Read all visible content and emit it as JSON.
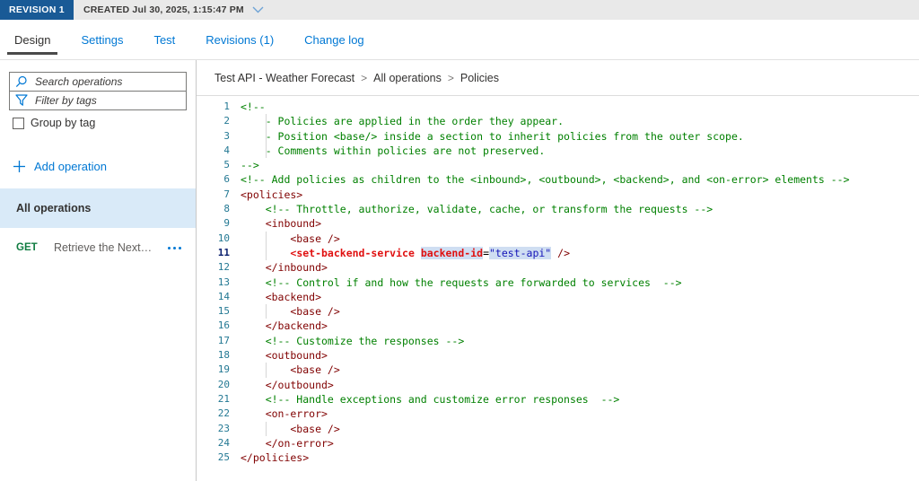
{
  "revision_bar": {
    "badge_label": "REVISION 1",
    "created_label": "CREATED Jul 30, 2025, 1:15:47 PM"
  },
  "tabs": [
    {
      "label": "Design",
      "active": true
    },
    {
      "label": "Settings",
      "active": false
    },
    {
      "label": "Test",
      "active": false
    },
    {
      "label": "Revisions (1)",
      "active": false
    },
    {
      "label": "Change log",
      "active": false
    }
  ],
  "sidebar": {
    "search_placeholder": "Search operations",
    "filter_placeholder": "Filter by tags",
    "group_by_tag_label": "Group by tag",
    "add_operation_label": "Add operation",
    "all_operations_label": "All operations",
    "operations": [
      {
        "verb": "GET",
        "name": "Retrieve the Next…"
      }
    ]
  },
  "breadcrumb": {
    "items": [
      "Test API - Weather Forecast",
      "All operations",
      "Policies"
    ],
    "separator": ">"
  },
  "editor": {
    "lines": [
      {
        "n": 1,
        "guide": false,
        "current": false,
        "tokens": [
          {
            "t": "<!--",
            "c": "comment"
          }
        ]
      },
      {
        "n": 2,
        "guide": true,
        "current": false,
        "tokens": [
          {
            "t": "    - Policies are applied in the order they appear.",
            "c": "comment"
          }
        ]
      },
      {
        "n": 3,
        "guide": true,
        "current": false,
        "tokens": [
          {
            "t": "    - Position <base/> inside a section to inherit policies from the outer scope.",
            "c": "comment"
          }
        ]
      },
      {
        "n": 4,
        "guide": true,
        "current": false,
        "tokens": [
          {
            "t": "    - Comments within policies are not preserved.",
            "c": "comment"
          }
        ]
      },
      {
        "n": 5,
        "guide": false,
        "current": false,
        "tokens": [
          {
            "t": "-->",
            "c": "comment"
          }
        ]
      },
      {
        "n": 6,
        "guide": false,
        "current": false,
        "tokens": [
          {
            "t": "<!-- Add policies as children to the <inbound>, <outbound>, <backend>, and <on-error> elements -->",
            "c": "comment"
          }
        ]
      },
      {
        "n": 7,
        "guide": false,
        "current": false,
        "tokens": [
          {
            "t": "<policies>",
            "c": "tag"
          }
        ]
      },
      {
        "n": 8,
        "guide": false,
        "current": false,
        "tokens": [
          {
            "t": "    <!-- Throttle, authorize, validate, cache, or transform the requests -->",
            "c": "comment"
          }
        ]
      },
      {
        "n": 9,
        "guide": false,
        "current": false,
        "tokens": [
          {
            "t": "    <inbound>",
            "c": "tag"
          }
        ]
      },
      {
        "n": 10,
        "guide": true,
        "current": false,
        "tokens": [
          {
            "t": "        <base />",
            "c": "tag"
          }
        ]
      },
      {
        "n": 11,
        "guide": true,
        "current": true,
        "tokens": [
          {
            "t": "        ",
            "c": "plain"
          },
          {
            "t": "<set-backend-service",
            "c": "redtag"
          },
          {
            "t": " ",
            "c": "plain"
          },
          {
            "t": "backend-id",
            "c": "attr",
            "hl": true
          },
          {
            "t": "=",
            "c": "plain"
          },
          {
            "t": "\"test-api\"",
            "c": "value",
            "hl": true
          },
          {
            "t": " />",
            "c": "tag"
          }
        ]
      },
      {
        "n": 12,
        "guide": false,
        "current": false,
        "tokens": [
          {
            "t": "    </inbound>",
            "c": "tag"
          }
        ]
      },
      {
        "n": 13,
        "guide": false,
        "current": false,
        "tokens": [
          {
            "t": "    <!-- Control if and how the requests are forwarded to services  -->",
            "c": "comment"
          }
        ]
      },
      {
        "n": 14,
        "guide": false,
        "current": false,
        "tokens": [
          {
            "t": "    <backend>",
            "c": "tag"
          }
        ]
      },
      {
        "n": 15,
        "guide": true,
        "current": false,
        "tokens": [
          {
            "t": "        <base />",
            "c": "tag"
          }
        ]
      },
      {
        "n": 16,
        "guide": false,
        "current": false,
        "tokens": [
          {
            "t": "    </backend>",
            "c": "tag"
          }
        ]
      },
      {
        "n": 17,
        "guide": false,
        "current": false,
        "tokens": [
          {
            "t": "    <!-- Customize the responses -->",
            "c": "comment"
          }
        ]
      },
      {
        "n": 18,
        "guide": false,
        "current": false,
        "tokens": [
          {
            "t": "    <outbound>",
            "c": "tag"
          }
        ]
      },
      {
        "n": 19,
        "guide": true,
        "current": false,
        "tokens": [
          {
            "t": "        <base />",
            "c": "tag"
          }
        ]
      },
      {
        "n": 20,
        "guide": false,
        "current": false,
        "tokens": [
          {
            "t": "    </outbound>",
            "c": "tag"
          }
        ]
      },
      {
        "n": 21,
        "guide": false,
        "current": false,
        "tokens": [
          {
            "t": "    <!-- Handle exceptions and customize error responses  -->",
            "c": "comment"
          }
        ]
      },
      {
        "n": 22,
        "guide": false,
        "current": false,
        "tokens": [
          {
            "t": "    <on-error>",
            "c": "tag"
          }
        ]
      },
      {
        "n": 23,
        "guide": true,
        "current": false,
        "tokens": [
          {
            "t": "        <base />",
            "c": "tag"
          }
        ]
      },
      {
        "n": 24,
        "guide": false,
        "current": false,
        "tokens": [
          {
            "t": "    </on-error>",
            "c": "tag"
          }
        ]
      },
      {
        "n": 25,
        "guide": false,
        "current": false,
        "tokens": [
          {
            "t": "</policies>",
            "c": "tag"
          }
        ]
      }
    ]
  },
  "colors": {
    "accent": "#0078d4",
    "badge_bg": "#195a96",
    "selected_row_bg": "#d9eaf8",
    "get_verb": "#107c41",
    "comment": "#008000",
    "tag": "#800000",
    "red": "#e01010",
    "attr_value": "#1414b8",
    "occurrence_highlight": "#cfdef2",
    "line_number": "#237893",
    "active_line_number": "#0b216f"
  }
}
